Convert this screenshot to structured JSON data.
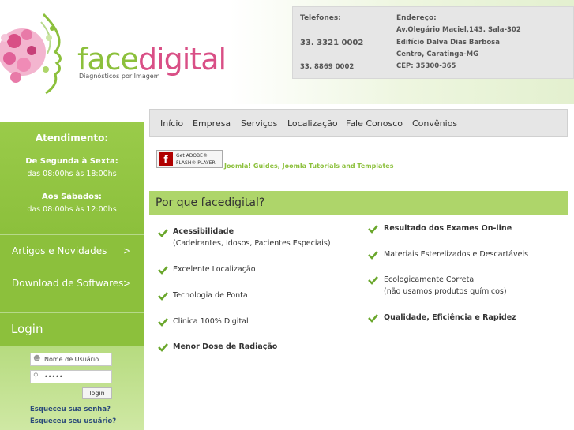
{
  "header": {
    "brand_face": "face",
    "brand_digital": "digital",
    "tagline": "Diagnósticos por Imagem",
    "contact": {
      "phones_label": "Telefones:",
      "phone1": "33. 3321 0002",
      "phone2": "33. 8869 0002",
      "address_label": "Endereço:",
      "address_line1": "Av.Olegário Maciel,143. Sala-302",
      "address_line2": "Edifício Dalva Dias Barbosa",
      "address_line3": "Centro, Caratinga-MG",
      "address_line4": "CEP: 35300-365"
    }
  },
  "sidebar": {
    "attend_title": "Atendimento:",
    "weekday_label": "De Segunda à Sexta:",
    "weekday_hours": "das 08:00hs às 18:00hs",
    "saturday_label": "Aos Sábados:",
    "saturday_hours": "das 08:00hs às 12:00hs",
    "menu": [
      {
        "label": "Artigos e Novidades",
        "arrow": ">"
      },
      {
        "label": "Download de Softwares",
        "arrow": ">"
      }
    ],
    "login": {
      "title": "Login",
      "username_placeholder": "Nome de Usuário",
      "password_value": "•••••",
      "button": "login",
      "forgot_password": "Esqueceu sua senha?",
      "forgot_username": "Esqueceu seu usuário?"
    }
  },
  "nav": [
    "Início",
    "Empresa",
    "Serviços",
    "Localização",
    "Fale Conosco",
    "Convênios"
  ],
  "flash": {
    "line1": "Get ADOBE®",
    "line2": "FLASH® PLAYER"
  },
  "joomla_link": "Joomla! Guides, Joomla Tutorials and Templates",
  "why": {
    "title": "Por que facedigital?",
    "left": [
      {
        "text": "Acessibilidade",
        "sub": "(Cadeirantes, Idosos, Pacientes Especiais)"
      },
      {
        "text": "Excelente Localização"
      },
      {
        "text": "Tecnologia de Ponta"
      },
      {
        "text": "Clínica 100% Digital"
      },
      {
        "text": "Menor Dose de Radiação"
      }
    ],
    "right": [
      {
        "text": "Resultado dos Exames On-line"
      },
      {
        "text": "Materiais Esterelizados e Descartáveis"
      },
      {
        "text": "Ecologicamente Correta",
        "sub": "(não usamos produtos químicos)"
      },
      {
        "text": "Qualidade, Eficiência e Rapidez"
      }
    ]
  },
  "colors": {
    "green": "#8cc03c",
    "pink": "#d94f86",
    "bar": "#aed56a"
  }
}
